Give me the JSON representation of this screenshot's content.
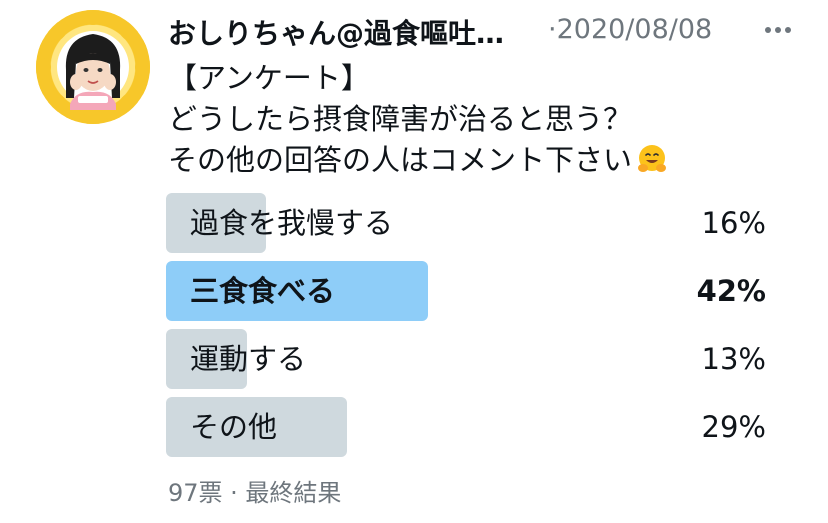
{
  "tweet": {
    "author": {
      "display_name": "おしりちゃん@過食嘔吐…",
      "avatar_icon": "avatar-icon"
    },
    "separator": "·",
    "date": "2020/08/08",
    "text_lines": [
      "【アンケート】",
      "どうしたら摂食障害が治ると思う？",
      "その他の回答の人はコメント下さい"
    ],
    "emoji": "hugging-face-emoji"
  },
  "poll": {
    "options": [
      {
        "label": "過食を我慢する",
        "percent_text": "16%",
        "percent": 16,
        "winner": false
      },
      {
        "label": "三食食べる",
        "percent_text": "42%",
        "percent": 42,
        "winner": true
      },
      {
        "label": "運動する",
        "percent_text": "13%",
        "percent": 13,
        "winner": false
      },
      {
        "label": "その他",
        "percent_text": "29%",
        "percent": 29,
        "winner": false
      }
    ],
    "footer": "97票 · 最終結果"
  },
  "colors": {
    "bar": "#cfd9de",
    "winner_bar": "#8ecdf8",
    "muted_text": "#6e767d",
    "avatar_frame": "#f7c72a"
  }
}
